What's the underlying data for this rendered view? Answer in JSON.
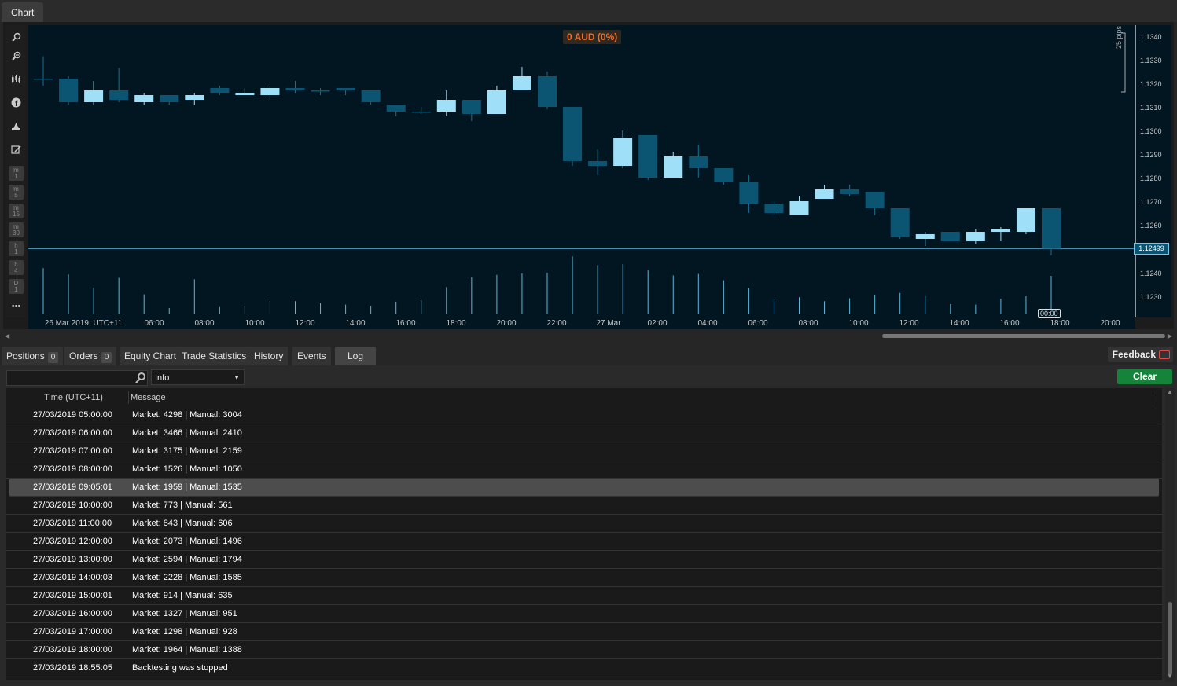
{
  "window": {
    "chart_tab_label": "Chart"
  },
  "chart": {
    "pnl_label": "0 AUD (0%)",
    "current_price": "1.12499",
    "pips_label": "25 pips",
    "hover_time": "00:00",
    "y_ticks": [
      "1.1340",
      "1.1330",
      "1.1320",
      "1.1310",
      "1.1300",
      "1.1290",
      "1.1280",
      "1.1270",
      "1.1260",
      "1.1240",
      "1.1230"
    ],
    "x_ticks": [
      "26 Mar 2019, UTC+11",
      "06:00",
      "08:00",
      "10:00",
      "12:00",
      "14:00",
      "16:00",
      "18:00",
      "20:00",
      "22:00",
      "27 Mar",
      "02:00",
      "04:00",
      "06:00",
      "08:00",
      "10:00",
      "12:00",
      "14:00",
      "16:00",
      "18:00",
      "20:00"
    ],
    "toolbar_icons": [
      "zoom-in-icon",
      "zoom-out-icon",
      "candles-icon",
      "facebook-icon",
      "objects-icon",
      "edit-icon"
    ],
    "timeframes": [
      [
        "m",
        "1"
      ],
      [
        "m",
        "5"
      ],
      [
        "m",
        "15"
      ],
      [
        "m",
        "30"
      ],
      [
        "h",
        "1"
      ],
      [
        "h",
        "4"
      ],
      [
        "D",
        "1"
      ]
    ],
    "more_label": "•••",
    "colors": {
      "background": "#011621",
      "bull": "#9fdff8",
      "bear": "#0b5573",
      "price_line": "#5fb6d9",
      "pnl": "#f26c2b"
    }
  },
  "chart_data": {
    "type": "candlestick",
    "title": "",
    "xlabel": "",
    "ylabel": "",
    "ylim": [
      1.1225,
      1.1345
    ],
    "time_axis": [
      "26 Mar 2019 04:00",
      "27 Mar 2019 19:00"
    ],
    "candles": [
      {
        "o": 1.1322,
        "h": 1.13315,
        "l": 1.1319,
        "c": 1.1322
      },
      {
        "o": 1.1322,
        "h": 1.1323,
        "l": 1.1311,
        "c": 1.1312
      },
      {
        "o": 1.1312,
        "h": 1.1321,
        "l": 1.1311,
        "c": 1.1317
      },
      {
        "o": 1.1317,
        "h": 1.13265,
        "l": 1.1312,
        "c": 1.1313
      },
      {
        "o": 1.1312,
        "h": 1.1316,
        "l": 1.1311,
        "c": 1.1315
      },
      {
        "o": 1.1315,
        "h": 1.1315,
        "l": 1.1311,
        "c": 1.1312
      },
      {
        "o": 1.1313,
        "h": 1.1316,
        "l": 1.1311,
        "c": 1.1315
      },
      {
        "o": 1.1318,
        "h": 1.1319,
        "l": 1.1315,
        "c": 1.1316
      },
      {
        "o": 1.1315,
        "h": 1.1318,
        "l": 1.1315,
        "c": 1.1316
      },
      {
        "o": 1.1315,
        "h": 1.1319,
        "l": 1.1313,
        "c": 1.1318
      },
      {
        "o": 1.1318,
        "h": 1.1321,
        "l": 1.1316,
        "c": 1.1317
      },
      {
        "o": 1.1317,
        "h": 1.1318,
        "l": 1.1315,
        "c": 1.1317
      },
      {
        "o": 1.1318,
        "h": 1.1318,
        "l": 1.1315,
        "c": 1.1317
      },
      {
        "o": 1.1317,
        "h": 1.1317,
        "l": 1.1311,
        "c": 1.1312
      },
      {
        "o": 1.1311,
        "h": 1.1311,
        "l": 1.1306,
        "c": 1.1308
      },
      {
        "o": 1.1308,
        "h": 1.131,
        "l": 1.1307,
        "c": 1.1308
      },
      {
        "o": 1.1308,
        "h": 1.1317,
        "l": 1.1306,
        "c": 1.1313
      },
      {
        "o": 1.1313,
        "h": 1.1313,
        "l": 1.1304,
        "c": 1.1307
      },
      {
        "o": 1.1307,
        "h": 1.1319,
        "l": 1.1307,
        "c": 1.1317
      },
      {
        "o": 1.1317,
        "h": 1.1327,
        "l": 1.1317,
        "c": 1.1323
      },
      {
        "o": 1.1323,
        "h": 1.1325,
        "l": 1.1309,
        "c": 1.131
      },
      {
        "o": 1.131,
        "h": 1.131,
        "l": 1.1285,
        "c": 1.1287
      },
      {
        "o": 1.1287,
        "h": 1.1292,
        "l": 1.1281,
        "c": 1.1285
      },
      {
        "o": 1.1285,
        "h": 1.13,
        "l": 1.1284,
        "c": 1.1297
      },
      {
        "o": 1.1298,
        "h": 1.1298,
        "l": 1.1279,
        "c": 1.128
      },
      {
        "o": 1.128,
        "h": 1.1291,
        "l": 1.128,
        "c": 1.1289
      },
      {
        "o": 1.1289,
        "h": 1.1294,
        "l": 1.128,
        "c": 1.1284
      },
      {
        "o": 1.1284,
        "h": 1.1284,
        "l": 1.1277,
        "c": 1.1278
      },
      {
        "o": 1.1278,
        "h": 1.1281,
        "l": 1.1265,
        "c": 1.1269
      },
      {
        "o": 1.1269,
        "h": 1.127,
        "l": 1.1264,
        "c": 1.1265
      },
      {
        "o": 1.1264,
        "h": 1.1272,
        "l": 1.1264,
        "c": 1.127
      },
      {
        "o": 1.1271,
        "h": 1.1277,
        "l": 1.1271,
        "c": 1.1275
      },
      {
        "o": 1.1275,
        "h": 1.1277,
        "l": 1.1272,
        "c": 1.1273
      },
      {
        "o": 1.1274,
        "h": 1.1274,
        "l": 1.1264,
        "c": 1.1267
      },
      {
        "o": 1.1267,
        "h": 1.1267,
        "l": 1.1254,
        "c": 1.1255
      },
      {
        "o": 1.1254,
        "h": 1.1257,
        "l": 1.1251,
        "c": 1.1256
      },
      {
        "o": 1.1257,
        "h": 1.1257,
        "l": 1.1254,
        "c": 1.1253
      },
      {
        "o": 1.1253,
        "h": 1.1258,
        "l": 1.1252,
        "c": 1.1257
      },
      {
        "o": 1.1257,
        "h": 1.1259,
        "l": 1.1253,
        "c": 1.1258
      },
      {
        "o": 1.1257,
        "h": 1.1267,
        "l": 1.1256,
        "c": 1.1267
      },
      {
        "o": 1.1267,
        "h": 1.1267,
        "l": 1.1247,
        "c": 1.12499
      }
    ],
    "volumes": [
      95,
      82,
      55,
      75,
      41,
      13,
      72,
      15,
      17,
      27,
      27,
      23,
      20,
      17,
      26,
      29,
      56,
      76,
      81,
      84,
      85,
      119,
      101,
      103,
      90,
      80,
      83,
      70,
      54,
      31,
      35,
      27,
      33,
      39,
      44,
      38,
      21,
      20,
      32,
      37,
      79
    ]
  },
  "tabs": [
    {
      "label": "Positions",
      "badge": "0"
    },
    {
      "label": "Orders",
      "badge": "0"
    },
    {
      "label": "Equity Chart"
    },
    {
      "label": "Trade Statistics"
    },
    {
      "label": "History"
    },
    {
      "label": "Events"
    },
    {
      "label": "Log"
    }
  ],
  "feedback_label": "Feedback",
  "log": {
    "search_value": "",
    "level": "Info",
    "clear_label": "Clear",
    "columns": [
      "Time (UTC+11)",
      "Message"
    ],
    "rows": [
      {
        "time": "27/03/2019 05:00:00",
        "message": "Market: 4298 | Manual: 3004"
      },
      {
        "time": "27/03/2019 06:00:00",
        "message": "Market: 3466 | Manual: 2410"
      },
      {
        "time": "27/03/2019 07:00:00",
        "message": "Market: 3175 | Manual: 2159"
      },
      {
        "time": "27/03/2019 08:00:00",
        "message": "Market: 1526 | Manual: 1050"
      },
      {
        "time": "27/03/2019 09:05:01",
        "message": "Market: 1959 | Manual: 1535"
      },
      {
        "time": "27/03/2019 10:00:00",
        "message": "Market: 773 | Manual: 561"
      },
      {
        "time": "27/03/2019 11:00:00",
        "message": "Market: 843 | Manual: 606"
      },
      {
        "time": "27/03/2019 12:00:00",
        "message": "Market: 2073 | Manual: 1496"
      },
      {
        "time": "27/03/2019 13:00:00",
        "message": "Market: 2594 | Manual: 1794"
      },
      {
        "time": "27/03/2019 14:00:03",
        "message": "Market: 2228 | Manual: 1585"
      },
      {
        "time": "27/03/2019 15:00:01",
        "message": "Market: 914 | Manual: 635"
      },
      {
        "time": "27/03/2019 16:00:00",
        "message": "Market: 1327 | Manual: 951"
      },
      {
        "time": "27/03/2019 17:00:00",
        "message": "Market: 1298 | Manual: 928"
      },
      {
        "time": "27/03/2019 18:00:00",
        "message": "Market: 1964 | Manual: 1388"
      },
      {
        "time": "27/03/2019 18:55:05",
        "message": "Backtesting was stopped"
      }
    ],
    "selected_row": 4
  }
}
